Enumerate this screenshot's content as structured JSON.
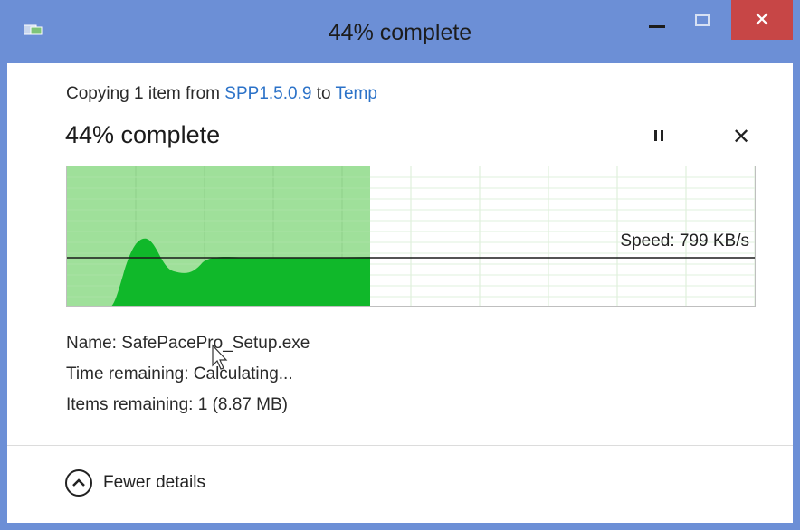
{
  "window": {
    "title": "44% complete",
    "titlebar_color": "#6c8fd6",
    "close_color": "#c74646"
  },
  "copy": {
    "prefix": "Copying 1 item from ",
    "source": "SPP1.5.0.9",
    "middle": " to ",
    "destination": "Temp"
  },
  "progress": {
    "label": "44% complete",
    "percent": 44
  },
  "graph": {
    "speed_label": "Speed: 799 KB/s",
    "fill_color": "#9fe09a",
    "curve_color": "#10b82a"
  },
  "details": {
    "name": "Name:  SafePacePro_Setup.exe",
    "time_remaining": "Time remaining:  Calculating...",
    "items_remaining": "Items remaining:  1 (8.87 MB)"
  },
  "footer": {
    "fewer_details": "Fewer details"
  },
  "icons": {
    "app": "copy-icon",
    "pause": "pause-icon",
    "cancel": "close-icon",
    "collapse": "chevron-up-icon",
    "cursor": "mouse-pointer-icon"
  }
}
